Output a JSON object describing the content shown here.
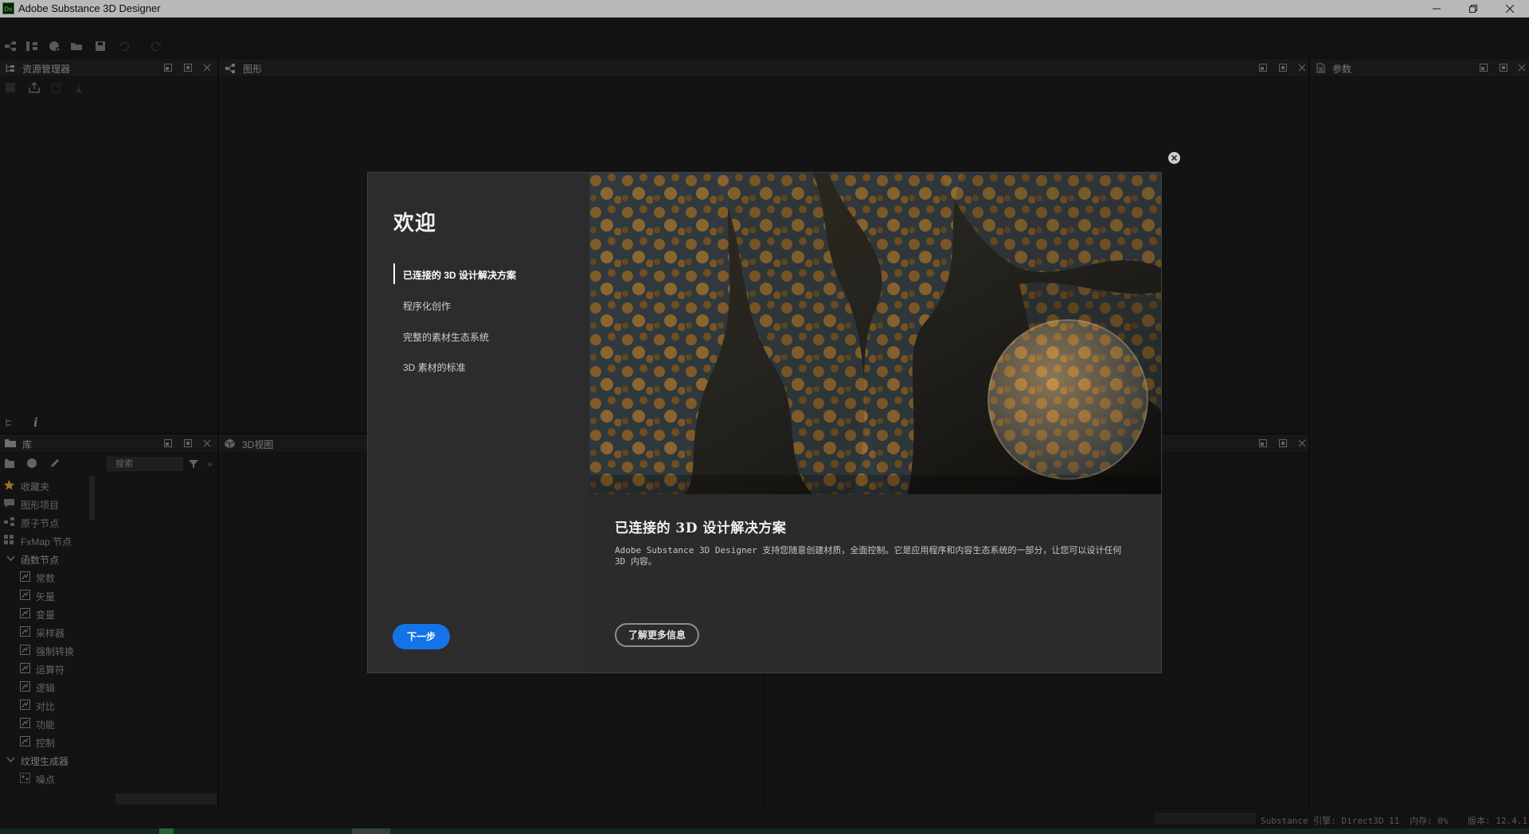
{
  "window": {
    "app_title": "Adobe Substance 3D Designer",
    "logo_text": "Ds"
  },
  "panels": {
    "explorer_title": "资源管理器",
    "graph_title": "图形",
    "params_title": "参数",
    "library_title": "库",
    "view3d_title": "3D视图"
  },
  "library": {
    "search_placeholder": "搜索",
    "items": [
      {
        "label": "收藏夹",
        "icon": "star-icon",
        "level": "top"
      },
      {
        "label": "图形项目",
        "icon": "comment-icon",
        "level": "top"
      },
      {
        "label": "原子节点",
        "icon": "nodes-icon",
        "level": "top"
      },
      {
        "label": "FxMap 节点",
        "icon": "grid-icon",
        "level": "top"
      },
      {
        "label": "函数节点",
        "icon": "chevron-down-icon",
        "level": "header"
      },
      {
        "label": "常数",
        "icon": "function-icon",
        "level": "sub"
      },
      {
        "label": "矢量",
        "icon": "function-icon",
        "level": "sub"
      },
      {
        "label": "变量",
        "icon": "function-icon",
        "level": "sub"
      },
      {
        "label": "采样器",
        "icon": "function-icon",
        "level": "sub"
      },
      {
        "label": "强制转换",
        "icon": "function-icon",
        "level": "sub"
      },
      {
        "label": "运算符",
        "icon": "function-icon",
        "level": "sub"
      },
      {
        "label": "逻辑",
        "icon": "function-icon",
        "level": "sub"
      },
      {
        "label": "对比",
        "icon": "function-icon",
        "level": "sub"
      },
      {
        "label": "功能",
        "icon": "function-icon",
        "level": "sub"
      },
      {
        "label": "控制",
        "icon": "function-icon",
        "level": "sub"
      },
      {
        "label": "纹理生成器",
        "icon": "chevron-down-icon",
        "level": "header"
      },
      {
        "label": "噪点",
        "icon": "noise-icon",
        "level": "sub"
      }
    ]
  },
  "welcome": {
    "title": "欢迎",
    "nav": [
      {
        "label": "已连接的 3D 设计解决方案",
        "active": true
      },
      {
        "label": "程序化创作",
        "active": false
      },
      {
        "label": "完整的素材生态系统",
        "active": false
      },
      {
        "label": "3D 素材的标准",
        "active": false
      }
    ],
    "next_label": "下一步",
    "heading": "已连接的 3D 设计解决方案",
    "body": "Adobe Substance 3D Designer 支持您随意创建材质，全面控制。它是应用程序和内容生态系统的一部分，让您可以设计任何 3D 内容。",
    "learn_more_label": "了解更多信息"
  },
  "status": {
    "engine": "Substance 引擎: Direct3D 11",
    "memory": "内存: 0%",
    "version": "版本: 12.4.1"
  },
  "colors": {
    "accent": "#1473e6",
    "background": "#1c1c1c"
  }
}
